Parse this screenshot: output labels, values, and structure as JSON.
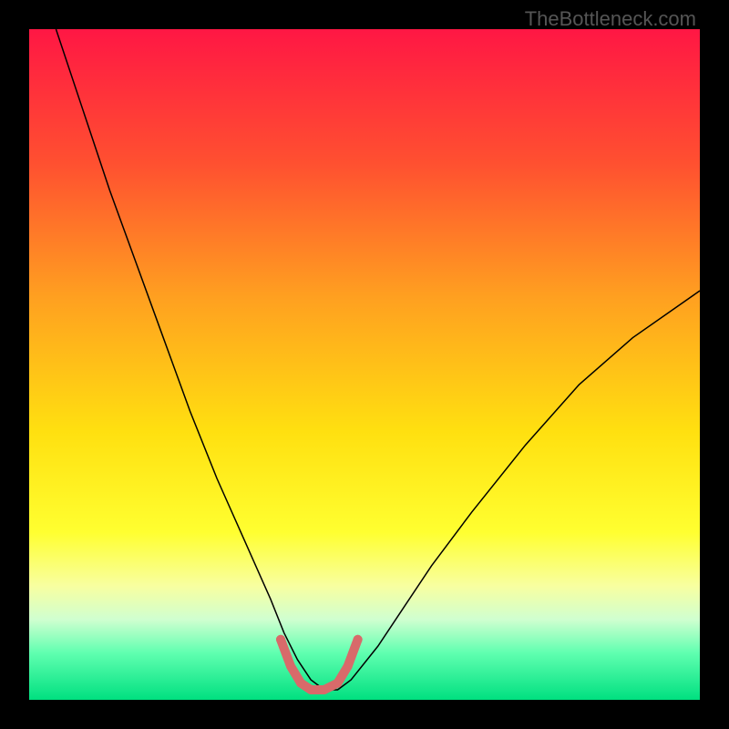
{
  "watermark": "TheBottleneck.com",
  "chart_data": {
    "type": "line",
    "title": "",
    "xlabel": "",
    "ylabel": "",
    "xlim": [
      0,
      100
    ],
    "ylim": [
      0,
      100
    ],
    "background_gradient": {
      "type": "vertical",
      "stops": [
        {
          "offset": 0.0,
          "color": "#ff1744"
        },
        {
          "offset": 0.2,
          "color": "#ff5030"
        },
        {
          "offset": 0.4,
          "color": "#ffa020"
        },
        {
          "offset": 0.6,
          "color": "#ffe010"
        },
        {
          "offset": 0.75,
          "color": "#ffff30"
        },
        {
          "offset": 0.83,
          "color": "#f8ffa0"
        },
        {
          "offset": 0.88,
          "color": "#d0ffd0"
        },
        {
          "offset": 0.93,
          "color": "#60ffb0"
        },
        {
          "offset": 1.0,
          "color": "#00e080"
        }
      ]
    },
    "series": [
      {
        "name": "bottleneck-curve",
        "color": "#000000",
        "width": 1.5,
        "x": [
          4,
          8,
          12,
          16,
          20,
          24,
          28,
          32,
          36,
          38,
          40,
          42,
          44,
          46,
          48,
          52,
          56,
          60,
          66,
          74,
          82,
          90,
          100
        ],
        "y": [
          100,
          88,
          76,
          65,
          54,
          43,
          33,
          24,
          15,
          10,
          6,
          3,
          1.5,
          1.5,
          3,
          8,
          14,
          20,
          28,
          38,
          47,
          54,
          61
        ]
      },
      {
        "name": "highlight-segment",
        "color": "#d86a6a",
        "width": 10,
        "linecap": "round",
        "x": [
          37.5,
          39,
          40.5,
          42,
          44,
          46,
          47.5,
          49
        ],
        "y": [
          9,
          5,
          2.5,
          1.5,
          1.5,
          2.5,
          5,
          9
        ]
      }
    ],
    "markers": [
      {
        "x": 37.5,
        "y": 9,
        "r": 5,
        "color": "#d86a6a"
      },
      {
        "x": 40.5,
        "y": 2.5,
        "r": 5,
        "color": "#d86a6a"
      },
      {
        "x": 42,
        "y": 1.5,
        "r": 5,
        "color": "#d86a6a"
      },
      {
        "x": 44,
        "y": 1.5,
        "r": 5,
        "color": "#d86a6a"
      },
      {
        "x": 46,
        "y": 2.5,
        "r": 5,
        "color": "#d86a6a"
      },
      {
        "x": 47.5,
        "y": 5,
        "r": 5,
        "color": "#d86a6a"
      },
      {
        "x": 49,
        "y": 9,
        "r": 5,
        "color": "#d86a6a"
      }
    ]
  }
}
